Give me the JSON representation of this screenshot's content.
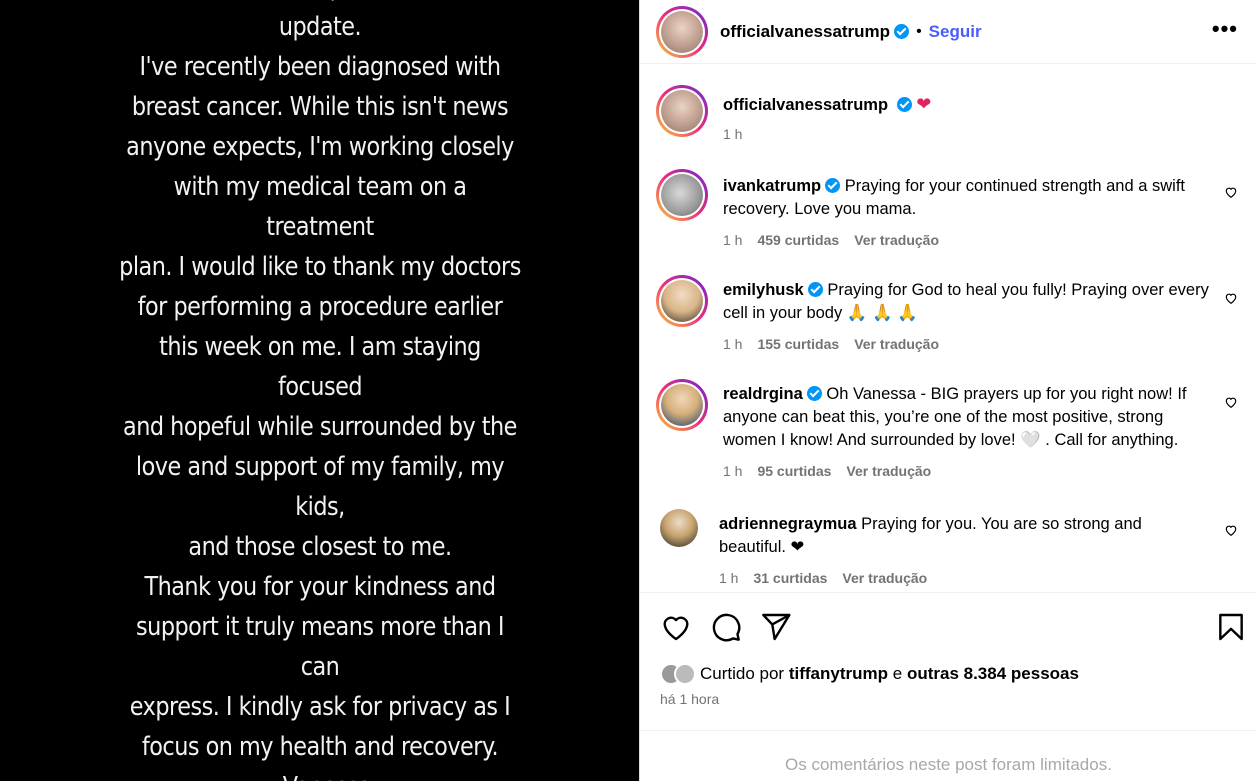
{
  "story": {
    "text": "I want to share a personal health\nupdate.\nI've recently been diagnosed with\nbreast cancer. While this isn't news\nanyone expects, I'm working closely\nwith my medical team on a treatment\nplan. I would like to thank my doctors\nfor performing a procedure earlier\nthis week on me. I am staying focused\nand hopeful while surrounded by the\nlove and support of my family, my kids,\nand those closest to me.\nThank you for your kindness and\nsupport it truly means more than I can\nexpress. I kindly ask for privacy as I\nfocus on my health and recovery.\n- Vanessa"
  },
  "header": {
    "username": "officialvanessatrump",
    "separator": "•",
    "follow_label": "Seguir",
    "more_label": "•••"
  },
  "caption": {
    "username": "officialvanessatrump",
    "emoji": "❤",
    "time": "1 h"
  },
  "comments": [
    {
      "username": "ivankatrump",
      "text": "Praying for your continued strength and a swift recovery. Love you mama.",
      "time": "1 h",
      "likes": "459 curtidas",
      "translate": "Ver tradução"
    },
    {
      "username": "emilyhusk",
      "text": "Praying for God to heal you fully! Praying over every cell in your body 🙏 🙏 🙏",
      "time": "1 h",
      "likes": "155 curtidas",
      "translate": "Ver tradução"
    },
    {
      "username": "realdrgina",
      "text": "Oh Vanessa - BIG prayers up for you right now! If anyone can beat this, you’re one of the most positive, strong women I know! And surrounded by love! 🤍 . Call for anything.",
      "time": "1 h",
      "likes": "95 curtidas",
      "translate": "Ver tradução"
    },
    {
      "username": "adriennegraymua",
      "text": "Praying for you. You are so strong and beautiful. ❤",
      "time": "1 h",
      "likes": "31 curtidas",
      "translate": "Ver tradução"
    }
  ],
  "likes": {
    "prefix": "Curtido por",
    "user": "tiffanytrump",
    "conj": "e",
    "others": "outras 8.384 pessoas"
  },
  "post_time": "há 1 hora",
  "limited_notice": "Os comentários neste post foram limitados.",
  "colors": {
    "follow": "#4a5df9",
    "verified": "#0095f6",
    "meta": "#737373",
    "heart": "#e0245e"
  }
}
